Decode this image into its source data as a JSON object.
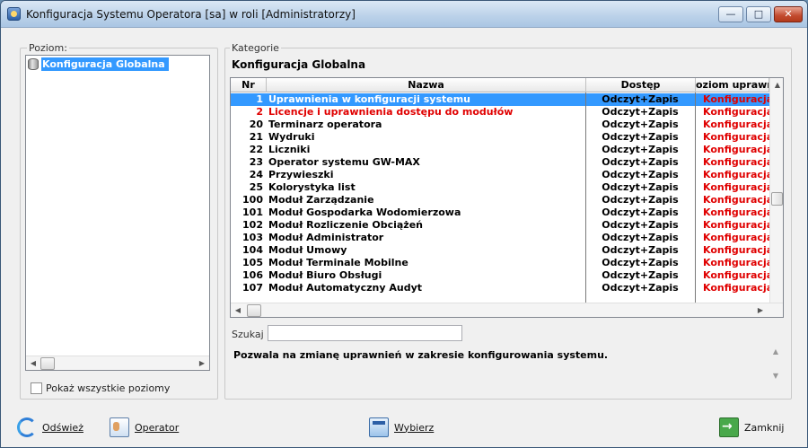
{
  "window": {
    "title": "Konfiguracja Systemu Operatora [sa] w roli [Administratorzy]",
    "min_glyph": "—",
    "max_glyph": "□",
    "close_glyph": "✕"
  },
  "level_panel": {
    "legend": "Poziom:",
    "tree_items": [
      "Konfiguracja Globalna"
    ],
    "show_all_label": "Pokaż wszystkie poziomy",
    "show_all_checked": false
  },
  "category_panel": {
    "legend": "Kategorie",
    "title": "Konfiguracja Globalna",
    "columns": [
      "Nr",
      "Nazwa",
      "Dostęp",
      "oziom uprawnie"
    ],
    "rows": [
      {
        "nr": "1",
        "name": "Uprawnienia w konfiguracji systemu",
        "access": "Odczyt+Zapis",
        "level": "Konfiguracja",
        "selected": true,
        "red": false
      },
      {
        "nr": "2",
        "name": "Licencje i uprawnienia dostępu do modułów",
        "access": "Odczyt+Zapis",
        "level": "Konfiguracja",
        "selected": false,
        "red": true
      },
      {
        "nr": "20",
        "name": "Terminarz operatora",
        "access": "Odczyt+Zapis",
        "level": "Konfiguracja",
        "selected": false,
        "red": false
      },
      {
        "nr": "21",
        "name": "Wydruki",
        "access": "Odczyt+Zapis",
        "level": "Konfiguracja",
        "selected": false,
        "red": false
      },
      {
        "nr": "22",
        "name": "Liczniki",
        "access": "Odczyt+Zapis",
        "level": "Konfiguracja",
        "selected": false,
        "red": false
      },
      {
        "nr": "23",
        "name": "Operator systemu GW-MAX",
        "access": "Odczyt+Zapis",
        "level": "Konfiguracja",
        "selected": false,
        "red": false
      },
      {
        "nr": "24",
        "name": "Przywieszki",
        "access": "Odczyt+Zapis",
        "level": "Konfiguracja",
        "selected": false,
        "red": false
      },
      {
        "nr": "25",
        "name": "Kolorystyka list",
        "access": "Odczyt+Zapis",
        "level": "Konfiguracja",
        "selected": false,
        "red": false
      },
      {
        "nr": "100",
        "name": "Moduł Zarządzanie",
        "access": "Odczyt+Zapis",
        "level": "Konfiguracja",
        "selected": false,
        "red": false
      },
      {
        "nr": "101",
        "name": "Moduł Gospodarka Wodomierzowa",
        "access": "Odczyt+Zapis",
        "level": "Konfiguracja",
        "selected": false,
        "red": false
      },
      {
        "nr": "102",
        "name": "Moduł Rozliczenie Obciążeń",
        "access": "Odczyt+Zapis",
        "level": "Konfiguracja",
        "selected": false,
        "red": false
      },
      {
        "nr": "103",
        "name": "Moduł Administrator",
        "access": "Odczyt+Zapis",
        "level": "Konfiguracja",
        "selected": false,
        "red": false
      },
      {
        "nr": "104",
        "name": "Moduł Umowy",
        "access": "Odczyt+Zapis",
        "level": "Konfiguracja",
        "selected": false,
        "red": false
      },
      {
        "nr": "105",
        "name": "Moduł Terminale Mobilne",
        "access": "Odczyt+Zapis",
        "level": "Konfiguracja",
        "selected": false,
        "red": false
      },
      {
        "nr": "106",
        "name": "Moduł Biuro Obsługi",
        "access": "Odczyt+Zapis",
        "level": "Konfiguracja",
        "selected": false,
        "red": false
      },
      {
        "nr": "107",
        "name": "Moduł Automatyczny Audyt",
        "access": "Odczyt+Zapis",
        "level": "Konfiguracja",
        "selected": false,
        "red": false
      }
    ],
    "search_label": "Szukaj",
    "search_value": "",
    "description": "Pozwala na zmianę uprawnień w zakresie konfigurowania systemu."
  },
  "toolbar": {
    "refresh_label": "Odśwież",
    "operator_label": "Operator",
    "select_label": "Wybierz",
    "close_label": "Zamknij"
  },
  "icons": {
    "refresh": "refresh-icon",
    "operator": "operator-icon",
    "select": "window-select-icon",
    "close": "exit-door-icon",
    "database": "database-icon"
  },
  "colors": {
    "selection": "#3399ff",
    "alert_text": "#e00000"
  }
}
